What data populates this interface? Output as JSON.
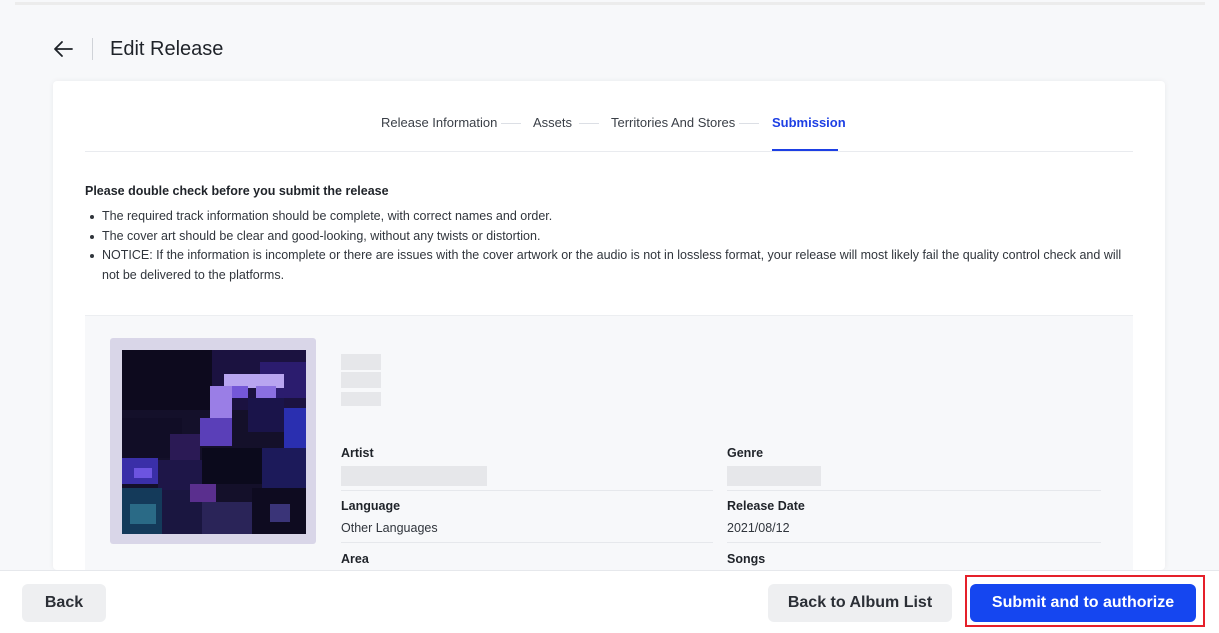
{
  "header": {
    "title": "Edit Release",
    "back_icon": "arrow-left-icon"
  },
  "steps": [
    {
      "label": "Release Information",
      "active": false
    },
    {
      "label": "Assets",
      "active": false
    },
    {
      "label": "Territories And Stores",
      "active": false
    },
    {
      "label": "Submission",
      "active": true
    }
  ],
  "notice": {
    "title": "Please double check before you submit the release",
    "items": [
      "The required track information should be complete, with correct names and order.",
      "The cover art should be clear and good-looking, without any twists or distortion.",
      "NOTICE: If the information is incomplete or there are issues with the cover artwork or the audio is not in lossless format, your release will most likely fail the quality control check and will not be delivered to the platforms."
    ]
  },
  "release": {
    "fields": {
      "artist": {
        "label": "Artist",
        "value": ""
      },
      "genre": {
        "label": "Genre",
        "value": ""
      },
      "language": {
        "label": "Language",
        "value": "Other Languages"
      },
      "release_date": {
        "label": "Release Date",
        "value": "2021/08/12"
      },
      "area": {
        "label": "Area"
      },
      "songs": {
        "label": "Songs"
      }
    }
  },
  "footer": {
    "back_label": "Back",
    "album_list_label": "Back to Album List",
    "submit_label": "Submit and to authorize"
  },
  "colors": {
    "accent": "#1d3fe4",
    "primary_button": "#1546f0",
    "highlight": "#e5202a"
  }
}
